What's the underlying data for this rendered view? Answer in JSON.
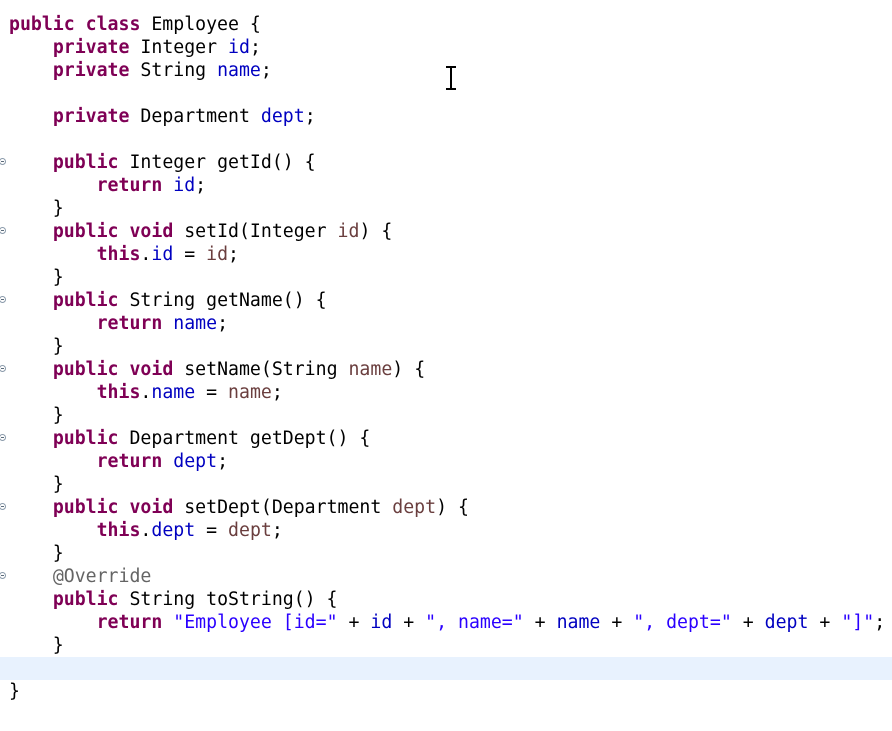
{
  "editor": {
    "language": "java",
    "colors": {
      "keyword": "#7f0055",
      "field": "#0000c0",
      "parameter": "#6a3e3e",
      "string": "#2a00ff",
      "annotation": "#646464",
      "current_line": "#e8f2fe"
    },
    "lines": [
      {
        "fold": false,
        "current": false,
        "tokens": [
          {
            "t": "kw",
            "v": "public"
          },
          {
            "t": "p",
            "v": " "
          },
          {
            "t": "kw",
            "v": "class"
          },
          {
            "t": "p",
            "v": " Employee {"
          }
        ]
      },
      {
        "fold": false,
        "current": false,
        "tokens": [
          {
            "t": "p",
            "v": "    "
          },
          {
            "t": "kw",
            "v": "private"
          },
          {
            "t": "p",
            "v": " Integer "
          },
          {
            "t": "fld",
            "v": "id"
          },
          {
            "t": "p",
            "v": ";"
          }
        ]
      },
      {
        "fold": false,
        "current": false,
        "tokens": [
          {
            "t": "p",
            "v": "    "
          },
          {
            "t": "kw",
            "v": "private"
          },
          {
            "t": "p",
            "v": " String "
          },
          {
            "t": "fld",
            "v": "name"
          },
          {
            "t": "p",
            "v": ";"
          }
        ]
      },
      {
        "fold": false,
        "current": false,
        "tokens": []
      },
      {
        "fold": false,
        "current": false,
        "tokens": [
          {
            "t": "p",
            "v": "    "
          },
          {
            "t": "kw",
            "v": "private"
          },
          {
            "t": "p",
            "v": " Department "
          },
          {
            "t": "fld",
            "v": "dept"
          },
          {
            "t": "p",
            "v": ";"
          }
        ]
      },
      {
        "fold": false,
        "current": false,
        "tokens": []
      },
      {
        "fold": true,
        "current": false,
        "tokens": [
          {
            "t": "p",
            "v": "    "
          },
          {
            "t": "kw",
            "v": "public"
          },
          {
            "t": "p",
            "v": " Integer getId() {"
          }
        ]
      },
      {
        "fold": false,
        "current": false,
        "tokens": [
          {
            "t": "p",
            "v": "        "
          },
          {
            "t": "kw",
            "v": "return"
          },
          {
            "t": "p",
            "v": " "
          },
          {
            "t": "fld",
            "v": "id"
          },
          {
            "t": "p",
            "v": ";"
          }
        ]
      },
      {
        "fold": false,
        "current": false,
        "tokens": [
          {
            "t": "p",
            "v": "    }"
          }
        ]
      },
      {
        "fold": true,
        "current": false,
        "tokens": [
          {
            "t": "p",
            "v": "    "
          },
          {
            "t": "kw",
            "v": "public"
          },
          {
            "t": "p",
            "v": " "
          },
          {
            "t": "kw",
            "v": "void"
          },
          {
            "t": "p",
            "v": " setId(Integer "
          },
          {
            "t": "prm",
            "v": "id"
          },
          {
            "t": "p",
            "v": ") {"
          }
        ]
      },
      {
        "fold": false,
        "current": false,
        "tokens": [
          {
            "t": "p",
            "v": "        "
          },
          {
            "t": "kw",
            "v": "this"
          },
          {
            "t": "p",
            "v": "."
          },
          {
            "t": "fld",
            "v": "id"
          },
          {
            "t": "p",
            "v": " = "
          },
          {
            "t": "prm",
            "v": "id"
          },
          {
            "t": "p",
            "v": ";"
          }
        ]
      },
      {
        "fold": false,
        "current": false,
        "tokens": [
          {
            "t": "p",
            "v": "    }"
          }
        ]
      },
      {
        "fold": true,
        "current": false,
        "tokens": [
          {
            "t": "p",
            "v": "    "
          },
          {
            "t": "kw",
            "v": "public"
          },
          {
            "t": "p",
            "v": " String getName() {"
          }
        ]
      },
      {
        "fold": false,
        "current": false,
        "tokens": [
          {
            "t": "p",
            "v": "        "
          },
          {
            "t": "kw",
            "v": "return"
          },
          {
            "t": "p",
            "v": " "
          },
          {
            "t": "fld",
            "v": "name"
          },
          {
            "t": "p",
            "v": ";"
          }
        ]
      },
      {
        "fold": false,
        "current": false,
        "tokens": [
          {
            "t": "p",
            "v": "    }"
          }
        ]
      },
      {
        "fold": true,
        "current": false,
        "tokens": [
          {
            "t": "p",
            "v": "    "
          },
          {
            "t": "kw",
            "v": "public"
          },
          {
            "t": "p",
            "v": " "
          },
          {
            "t": "kw",
            "v": "void"
          },
          {
            "t": "p",
            "v": " setName(String "
          },
          {
            "t": "prm",
            "v": "name"
          },
          {
            "t": "p",
            "v": ") {"
          }
        ]
      },
      {
        "fold": false,
        "current": false,
        "tokens": [
          {
            "t": "p",
            "v": "        "
          },
          {
            "t": "kw",
            "v": "this"
          },
          {
            "t": "p",
            "v": "."
          },
          {
            "t": "fld",
            "v": "name"
          },
          {
            "t": "p",
            "v": " = "
          },
          {
            "t": "prm",
            "v": "name"
          },
          {
            "t": "p",
            "v": ";"
          }
        ]
      },
      {
        "fold": false,
        "current": false,
        "tokens": [
          {
            "t": "p",
            "v": "    }"
          }
        ]
      },
      {
        "fold": true,
        "current": false,
        "tokens": [
          {
            "t": "p",
            "v": "    "
          },
          {
            "t": "kw",
            "v": "public"
          },
          {
            "t": "p",
            "v": " Department getDept() {"
          }
        ]
      },
      {
        "fold": false,
        "current": false,
        "tokens": [
          {
            "t": "p",
            "v": "        "
          },
          {
            "t": "kw",
            "v": "return"
          },
          {
            "t": "p",
            "v": " "
          },
          {
            "t": "fld",
            "v": "dept"
          },
          {
            "t": "p",
            "v": ";"
          }
        ]
      },
      {
        "fold": false,
        "current": false,
        "tokens": [
          {
            "t": "p",
            "v": "    }"
          }
        ]
      },
      {
        "fold": true,
        "current": false,
        "tokens": [
          {
            "t": "p",
            "v": "    "
          },
          {
            "t": "kw",
            "v": "public"
          },
          {
            "t": "p",
            "v": " "
          },
          {
            "t": "kw",
            "v": "void"
          },
          {
            "t": "p",
            "v": " setDept(Department "
          },
          {
            "t": "prm",
            "v": "dept"
          },
          {
            "t": "p",
            "v": ") {"
          }
        ]
      },
      {
        "fold": false,
        "current": false,
        "tokens": [
          {
            "t": "p",
            "v": "        "
          },
          {
            "t": "kw",
            "v": "this"
          },
          {
            "t": "p",
            "v": "."
          },
          {
            "t": "fld",
            "v": "dept"
          },
          {
            "t": "p",
            "v": " = "
          },
          {
            "t": "prm",
            "v": "dept"
          },
          {
            "t": "p",
            "v": ";"
          }
        ]
      },
      {
        "fold": false,
        "current": false,
        "tokens": [
          {
            "t": "p",
            "v": "    }"
          }
        ]
      },
      {
        "fold": true,
        "current": false,
        "tokens": [
          {
            "t": "p",
            "v": "    "
          },
          {
            "t": "ann",
            "v": "@Override"
          }
        ]
      },
      {
        "fold": false,
        "current": false,
        "tokens": [
          {
            "t": "p",
            "v": "    "
          },
          {
            "t": "kw",
            "v": "public"
          },
          {
            "t": "p",
            "v": " String toString() {"
          }
        ]
      },
      {
        "fold": false,
        "current": false,
        "tokens": [
          {
            "t": "p",
            "v": "        "
          },
          {
            "t": "kw",
            "v": "return"
          },
          {
            "t": "p",
            "v": " "
          },
          {
            "t": "str",
            "v": "\"Employee [id=\""
          },
          {
            "t": "p",
            "v": " + "
          },
          {
            "t": "fld",
            "v": "id"
          },
          {
            "t": "p",
            "v": " + "
          },
          {
            "t": "str",
            "v": "\", name=\""
          },
          {
            "t": "p",
            "v": " + "
          },
          {
            "t": "fld",
            "v": "name"
          },
          {
            "t": "p",
            "v": " + "
          },
          {
            "t": "str",
            "v": "\", dept=\""
          },
          {
            "t": "p",
            "v": " + "
          },
          {
            "t": "fld",
            "v": "dept"
          },
          {
            "t": "p",
            "v": " + "
          },
          {
            "t": "str",
            "v": "\"]\""
          },
          {
            "t": "p",
            "v": ";"
          }
        ]
      },
      {
        "fold": false,
        "current": false,
        "tokens": [
          {
            "t": "p",
            "v": "    }"
          }
        ]
      },
      {
        "fold": false,
        "current": true,
        "tokens": []
      },
      {
        "fold": false,
        "current": false,
        "tokens": [
          {
            "t": "p",
            "v": "}"
          }
        ]
      }
    ],
    "mouse_cursor": "i-beam-icon"
  }
}
